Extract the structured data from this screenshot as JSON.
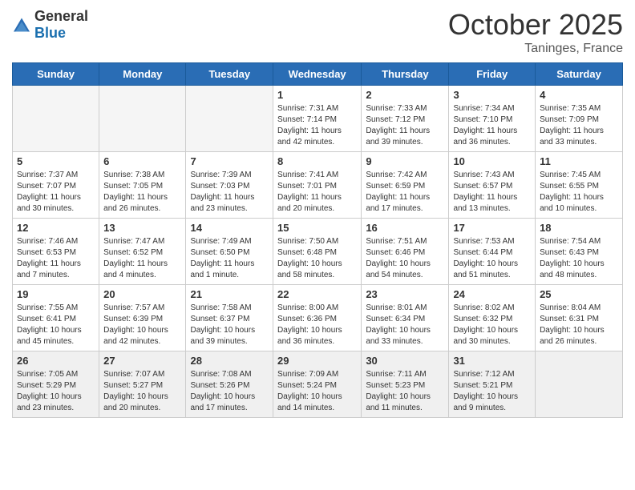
{
  "header": {
    "logo_general": "General",
    "logo_blue": "Blue",
    "month": "October 2025",
    "location": "Taninges, France"
  },
  "weekdays": [
    "Sunday",
    "Monday",
    "Tuesday",
    "Wednesday",
    "Thursday",
    "Friday",
    "Saturday"
  ],
  "weeks": [
    [
      {
        "day": "",
        "info": ""
      },
      {
        "day": "",
        "info": ""
      },
      {
        "day": "",
        "info": ""
      },
      {
        "day": "1",
        "info": "Sunrise: 7:31 AM\nSunset: 7:14 PM\nDaylight: 11 hours\nand 42 minutes."
      },
      {
        "day": "2",
        "info": "Sunrise: 7:33 AM\nSunset: 7:12 PM\nDaylight: 11 hours\nand 39 minutes."
      },
      {
        "day": "3",
        "info": "Sunrise: 7:34 AM\nSunset: 7:10 PM\nDaylight: 11 hours\nand 36 minutes."
      },
      {
        "day": "4",
        "info": "Sunrise: 7:35 AM\nSunset: 7:09 PM\nDaylight: 11 hours\nand 33 minutes."
      }
    ],
    [
      {
        "day": "5",
        "info": "Sunrise: 7:37 AM\nSunset: 7:07 PM\nDaylight: 11 hours\nand 30 minutes."
      },
      {
        "day": "6",
        "info": "Sunrise: 7:38 AM\nSunset: 7:05 PM\nDaylight: 11 hours\nand 26 minutes."
      },
      {
        "day": "7",
        "info": "Sunrise: 7:39 AM\nSunset: 7:03 PM\nDaylight: 11 hours\nand 23 minutes."
      },
      {
        "day": "8",
        "info": "Sunrise: 7:41 AM\nSunset: 7:01 PM\nDaylight: 11 hours\nand 20 minutes."
      },
      {
        "day": "9",
        "info": "Sunrise: 7:42 AM\nSunset: 6:59 PM\nDaylight: 11 hours\nand 17 minutes."
      },
      {
        "day": "10",
        "info": "Sunrise: 7:43 AM\nSunset: 6:57 PM\nDaylight: 11 hours\nand 13 minutes."
      },
      {
        "day": "11",
        "info": "Sunrise: 7:45 AM\nSunset: 6:55 PM\nDaylight: 11 hours\nand 10 minutes."
      }
    ],
    [
      {
        "day": "12",
        "info": "Sunrise: 7:46 AM\nSunset: 6:53 PM\nDaylight: 11 hours\nand 7 minutes."
      },
      {
        "day": "13",
        "info": "Sunrise: 7:47 AM\nSunset: 6:52 PM\nDaylight: 11 hours\nand 4 minutes."
      },
      {
        "day": "14",
        "info": "Sunrise: 7:49 AM\nSunset: 6:50 PM\nDaylight: 11 hours\nand 1 minute."
      },
      {
        "day": "15",
        "info": "Sunrise: 7:50 AM\nSunset: 6:48 PM\nDaylight: 10 hours\nand 58 minutes."
      },
      {
        "day": "16",
        "info": "Sunrise: 7:51 AM\nSunset: 6:46 PM\nDaylight: 10 hours\nand 54 minutes."
      },
      {
        "day": "17",
        "info": "Sunrise: 7:53 AM\nSunset: 6:44 PM\nDaylight: 10 hours\nand 51 minutes."
      },
      {
        "day": "18",
        "info": "Sunrise: 7:54 AM\nSunset: 6:43 PM\nDaylight: 10 hours\nand 48 minutes."
      }
    ],
    [
      {
        "day": "19",
        "info": "Sunrise: 7:55 AM\nSunset: 6:41 PM\nDaylight: 10 hours\nand 45 minutes."
      },
      {
        "day": "20",
        "info": "Sunrise: 7:57 AM\nSunset: 6:39 PM\nDaylight: 10 hours\nand 42 minutes."
      },
      {
        "day": "21",
        "info": "Sunrise: 7:58 AM\nSunset: 6:37 PM\nDaylight: 10 hours\nand 39 minutes."
      },
      {
        "day": "22",
        "info": "Sunrise: 8:00 AM\nSunset: 6:36 PM\nDaylight: 10 hours\nand 36 minutes."
      },
      {
        "day": "23",
        "info": "Sunrise: 8:01 AM\nSunset: 6:34 PM\nDaylight: 10 hours\nand 33 minutes."
      },
      {
        "day": "24",
        "info": "Sunrise: 8:02 AM\nSunset: 6:32 PM\nDaylight: 10 hours\nand 30 minutes."
      },
      {
        "day": "25",
        "info": "Sunrise: 8:04 AM\nSunset: 6:31 PM\nDaylight: 10 hours\nand 26 minutes."
      }
    ],
    [
      {
        "day": "26",
        "info": "Sunrise: 7:05 AM\nSunset: 5:29 PM\nDaylight: 10 hours\nand 23 minutes."
      },
      {
        "day": "27",
        "info": "Sunrise: 7:07 AM\nSunset: 5:27 PM\nDaylight: 10 hours\nand 20 minutes."
      },
      {
        "day": "28",
        "info": "Sunrise: 7:08 AM\nSunset: 5:26 PM\nDaylight: 10 hours\nand 17 minutes."
      },
      {
        "day": "29",
        "info": "Sunrise: 7:09 AM\nSunset: 5:24 PM\nDaylight: 10 hours\nand 14 minutes."
      },
      {
        "day": "30",
        "info": "Sunrise: 7:11 AM\nSunset: 5:23 PM\nDaylight: 10 hours\nand 11 minutes."
      },
      {
        "day": "31",
        "info": "Sunrise: 7:12 AM\nSunset: 5:21 PM\nDaylight: 10 hours\nand 9 minutes."
      },
      {
        "day": "",
        "info": ""
      }
    ]
  ]
}
